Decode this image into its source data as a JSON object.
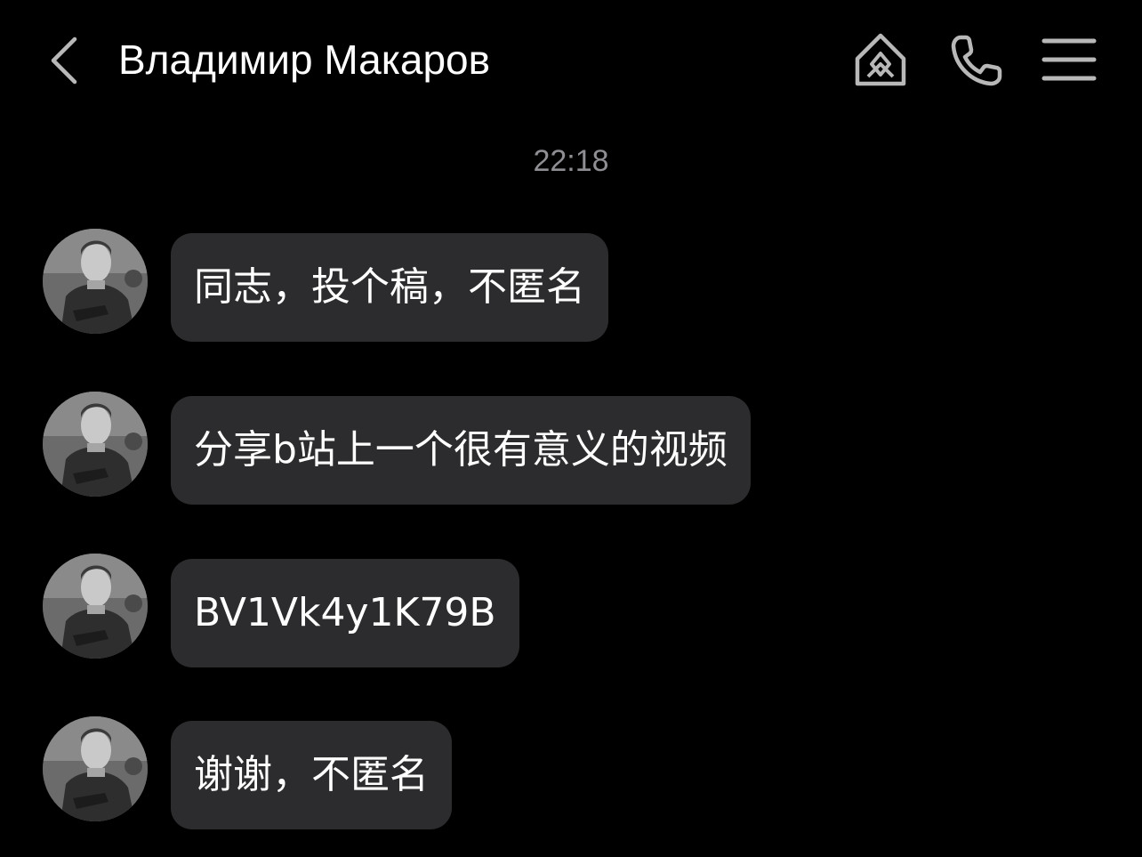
{
  "header": {
    "title": "Владимир Макаров",
    "back_icon": "chevron-left-icon",
    "icons": [
      "home-diamond-icon",
      "phone-icon",
      "menu-icon"
    ],
    "icon_color": "#b8b8b8"
  },
  "chat": {
    "timestamp": "22:18",
    "messages": [
      {
        "sender": "Владимир Макаров",
        "text": "同志，投个稿，不匿名"
      },
      {
        "sender": "Владимир Макаров",
        "text": "分享b站上一个很有意义的视频"
      },
      {
        "sender": "Владимир Макаров",
        "text": "BV1Vk4y1K79B"
      },
      {
        "sender": "Владимир Макаров",
        "text": "谢谢，不匿名"
      }
    ]
  },
  "colors": {
    "background": "#000000",
    "bubble": "#2c2c2e",
    "timestamp": "#8e8e93",
    "text": "#ffffff"
  }
}
